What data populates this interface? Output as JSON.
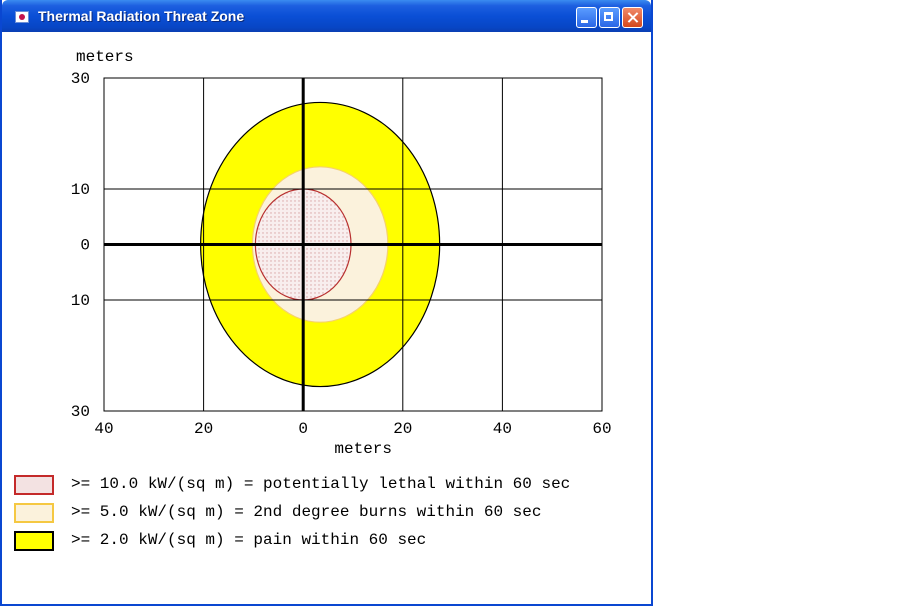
{
  "window": {
    "title": "Thermal Radiation Threat Zone"
  },
  "chart_data": {
    "type": "threat-zone",
    "ylabel": "meters",
    "xlabel": "meters",
    "x_ticks": [
      "40",
      "20",
      "0",
      "20",
      "40",
      "60"
    ],
    "x_values": [
      -40,
      -20,
      0,
      20,
      40,
      60
    ],
    "y_ticks": [
      "30",
      "10",
      "0",
      "10",
      "30"
    ],
    "y_values": [
      30,
      10,
      0,
      -10,
      -30
    ],
    "xlim": [
      -40,
      60
    ],
    "ylim": [
      -30,
      30
    ],
    "grid": true,
    "zones": [
      {
        "name": "yellow",
        "x_min": -20.6,
        "x_max": 27.4,
        "y_min": -25.6,
        "y_max": 25.6,
        "fill": "#ffff00",
        "stroke": "#000000"
      },
      {
        "name": "orange",
        "x_min": -10.2,
        "x_max": 17,
        "y_min": -14,
        "y_max": 14,
        "fill": "#fbf2dc",
        "stroke": "#f5d26a"
      },
      {
        "name": "red",
        "x_min": -9.6,
        "x_max": 9.6,
        "y_min": -10,
        "y_max": 10,
        "fill": "#f8eaea",
        "stroke": "#b83030"
      }
    ]
  },
  "legend": [
    {
      "text": ">= 10.0 kW/(sq m) = potentially lethal within 60 sec",
      "fill": "#f3e2e2",
      "border": "#c42a2a"
    },
    {
      "text": ">= 5.0 kW/(sq m) = 2nd degree burns within 60 sec",
      "fill": "#fbf2dc",
      "border": "#f5c842"
    },
    {
      "text": ">= 2.0 kW/(sq m) = pain within 60 sec",
      "fill": "#ffff00",
      "border": "#000000"
    }
  ]
}
